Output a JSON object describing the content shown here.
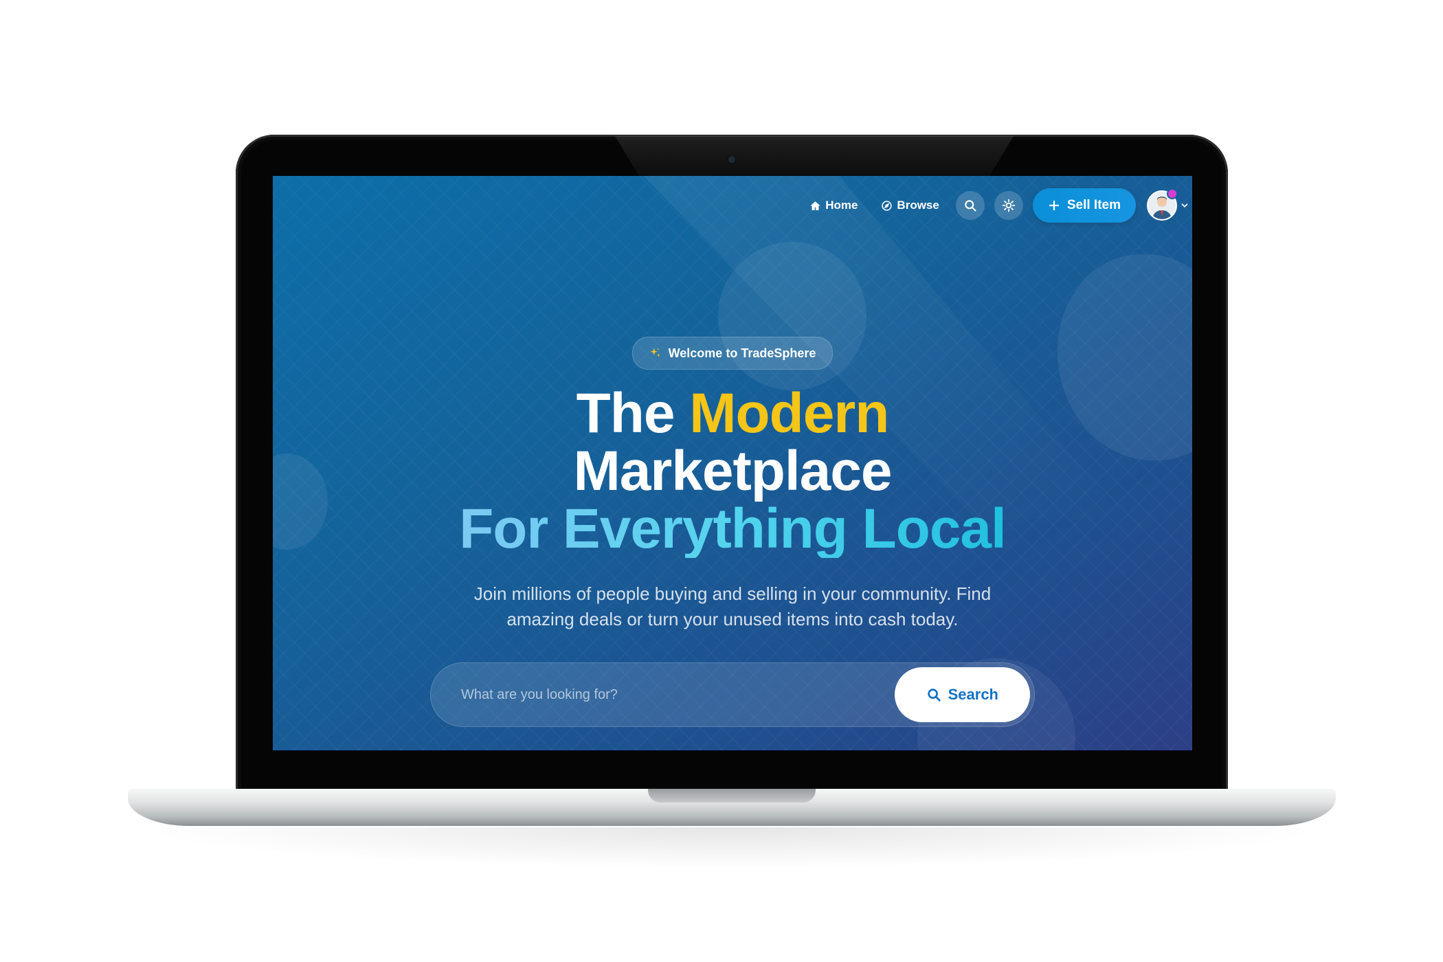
{
  "nav": {
    "home_label": "Home",
    "browse_label": "Browse",
    "sell_label": "Sell Item",
    "icons": [
      "home-icon",
      "compass-icon",
      "search-icon",
      "sun-icon",
      "plus-icon",
      "chevron-down-icon"
    ]
  },
  "hero": {
    "badge": "Welcome to TradeSphere",
    "title_the": "The",
    "title_modern": "Modern",
    "title_marketplace": "Marketplace",
    "title_line3": "For Everything Local",
    "subtitle": "Join millions of people buying and selling in your community. Find amazing deals or turn your unused items into cash today."
  },
  "search": {
    "placeholder": "What are you looking for?",
    "button_label": "Search"
  },
  "colors": {
    "accent_yellow": "#f5c518",
    "accent_cyan": "#54d4ee",
    "primary_button": "#0a8fd8",
    "notification_dot": "#d43fd3"
  }
}
